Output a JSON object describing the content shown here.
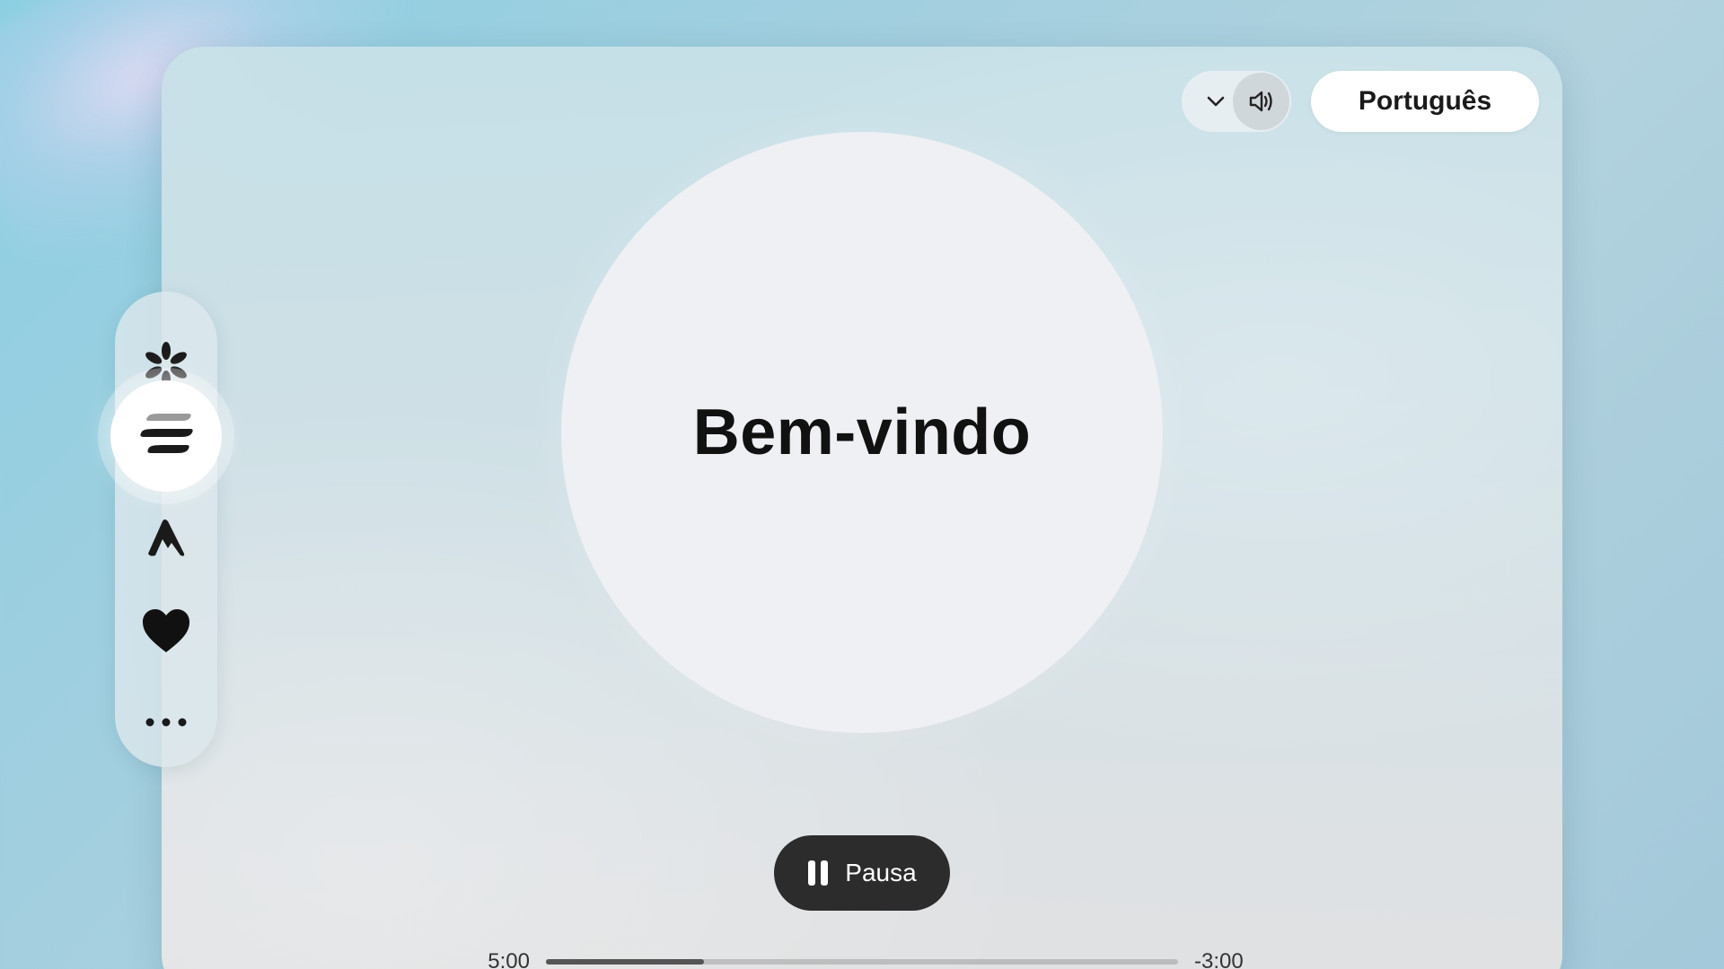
{
  "header": {
    "language_label": "Português"
  },
  "main": {
    "title": "Bem-vindo"
  },
  "player": {
    "pause_label": "Pausa",
    "elapsed": "5:00",
    "remaining": "-3:00",
    "progress": 0.25
  },
  "sidebar": {
    "items": [
      {
        "icon": "sparkle-asterisk-icon",
        "active": false
      },
      {
        "icon": "wave-layers-icon",
        "active": true
      },
      {
        "icon": "peak-icon",
        "active": false
      },
      {
        "icon": "heart-icon",
        "active": false
      },
      {
        "icon": "more-dots-icon",
        "active": false
      }
    ]
  },
  "colors": {
    "pause_button_bg": "#2c2c2c",
    "circle_bg": "#eff0f4",
    "progress_fill": "#555555"
  }
}
